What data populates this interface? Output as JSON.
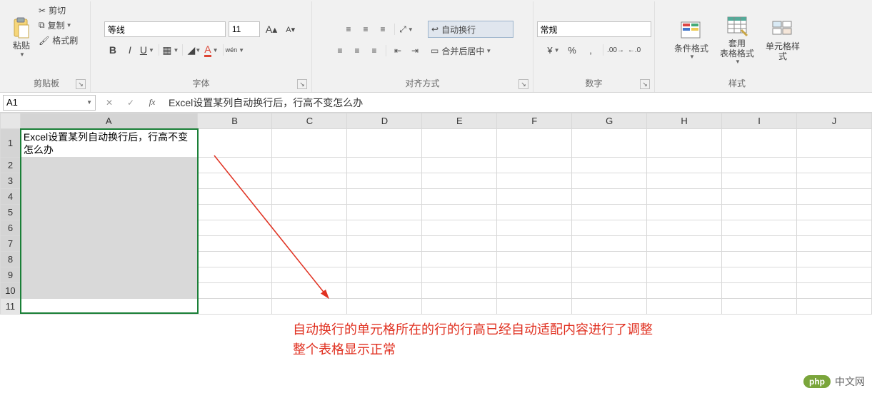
{
  "ribbon": {
    "clipboard": {
      "paste": "粘贴",
      "cut": "剪切",
      "copy": "复制",
      "format_painter": "格式刷",
      "group_label": "剪贴板"
    },
    "font": {
      "font_name": "等线",
      "font_size": "11",
      "bold": "B",
      "italic": "I",
      "underline": "U",
      "group_label": "字体",
      "phonetic": "wén"
    },
    "alignment": {
      "wrap_text": "自动换行",
      "merge_center": "合并后居中",
      "group_label": "对齐方式"
    },
    "number": {
      "format": "常规",
      "group_label": "数字"
    },
    "styles": {
      "conditional": "条件格式",
      "format_table": "套用\n表格格式",
      "cell_styles": "单元格样式",
      "group_label": "样式"
    }
  },
  "name_box": "A1",
  "formula_text": "Excel设置某列自动换行后，行高不变怎么办",
  "columns": [
    "A",
    "B",
    "C",
    "D",
    "E",
    "F",
    "G",
    "H",
    "I",
    "J"
  ],
  "rows": [
    1,
    2,
    3,
    4,
    5,
    6,
    7,
    8,
    9,
    10,
    11
  ],
  "cell_A1": "Excel设置某列自动换行后，行高不变怎么办",
  "annotation_line1": "自动换行的单元格所在的行的行高已经自动适配内容进行了调整",
  "annotation_line2": "整个表格显示正常",
  "watermark": {
    "logo": "php",
    "text": "中文网"
  }
}
